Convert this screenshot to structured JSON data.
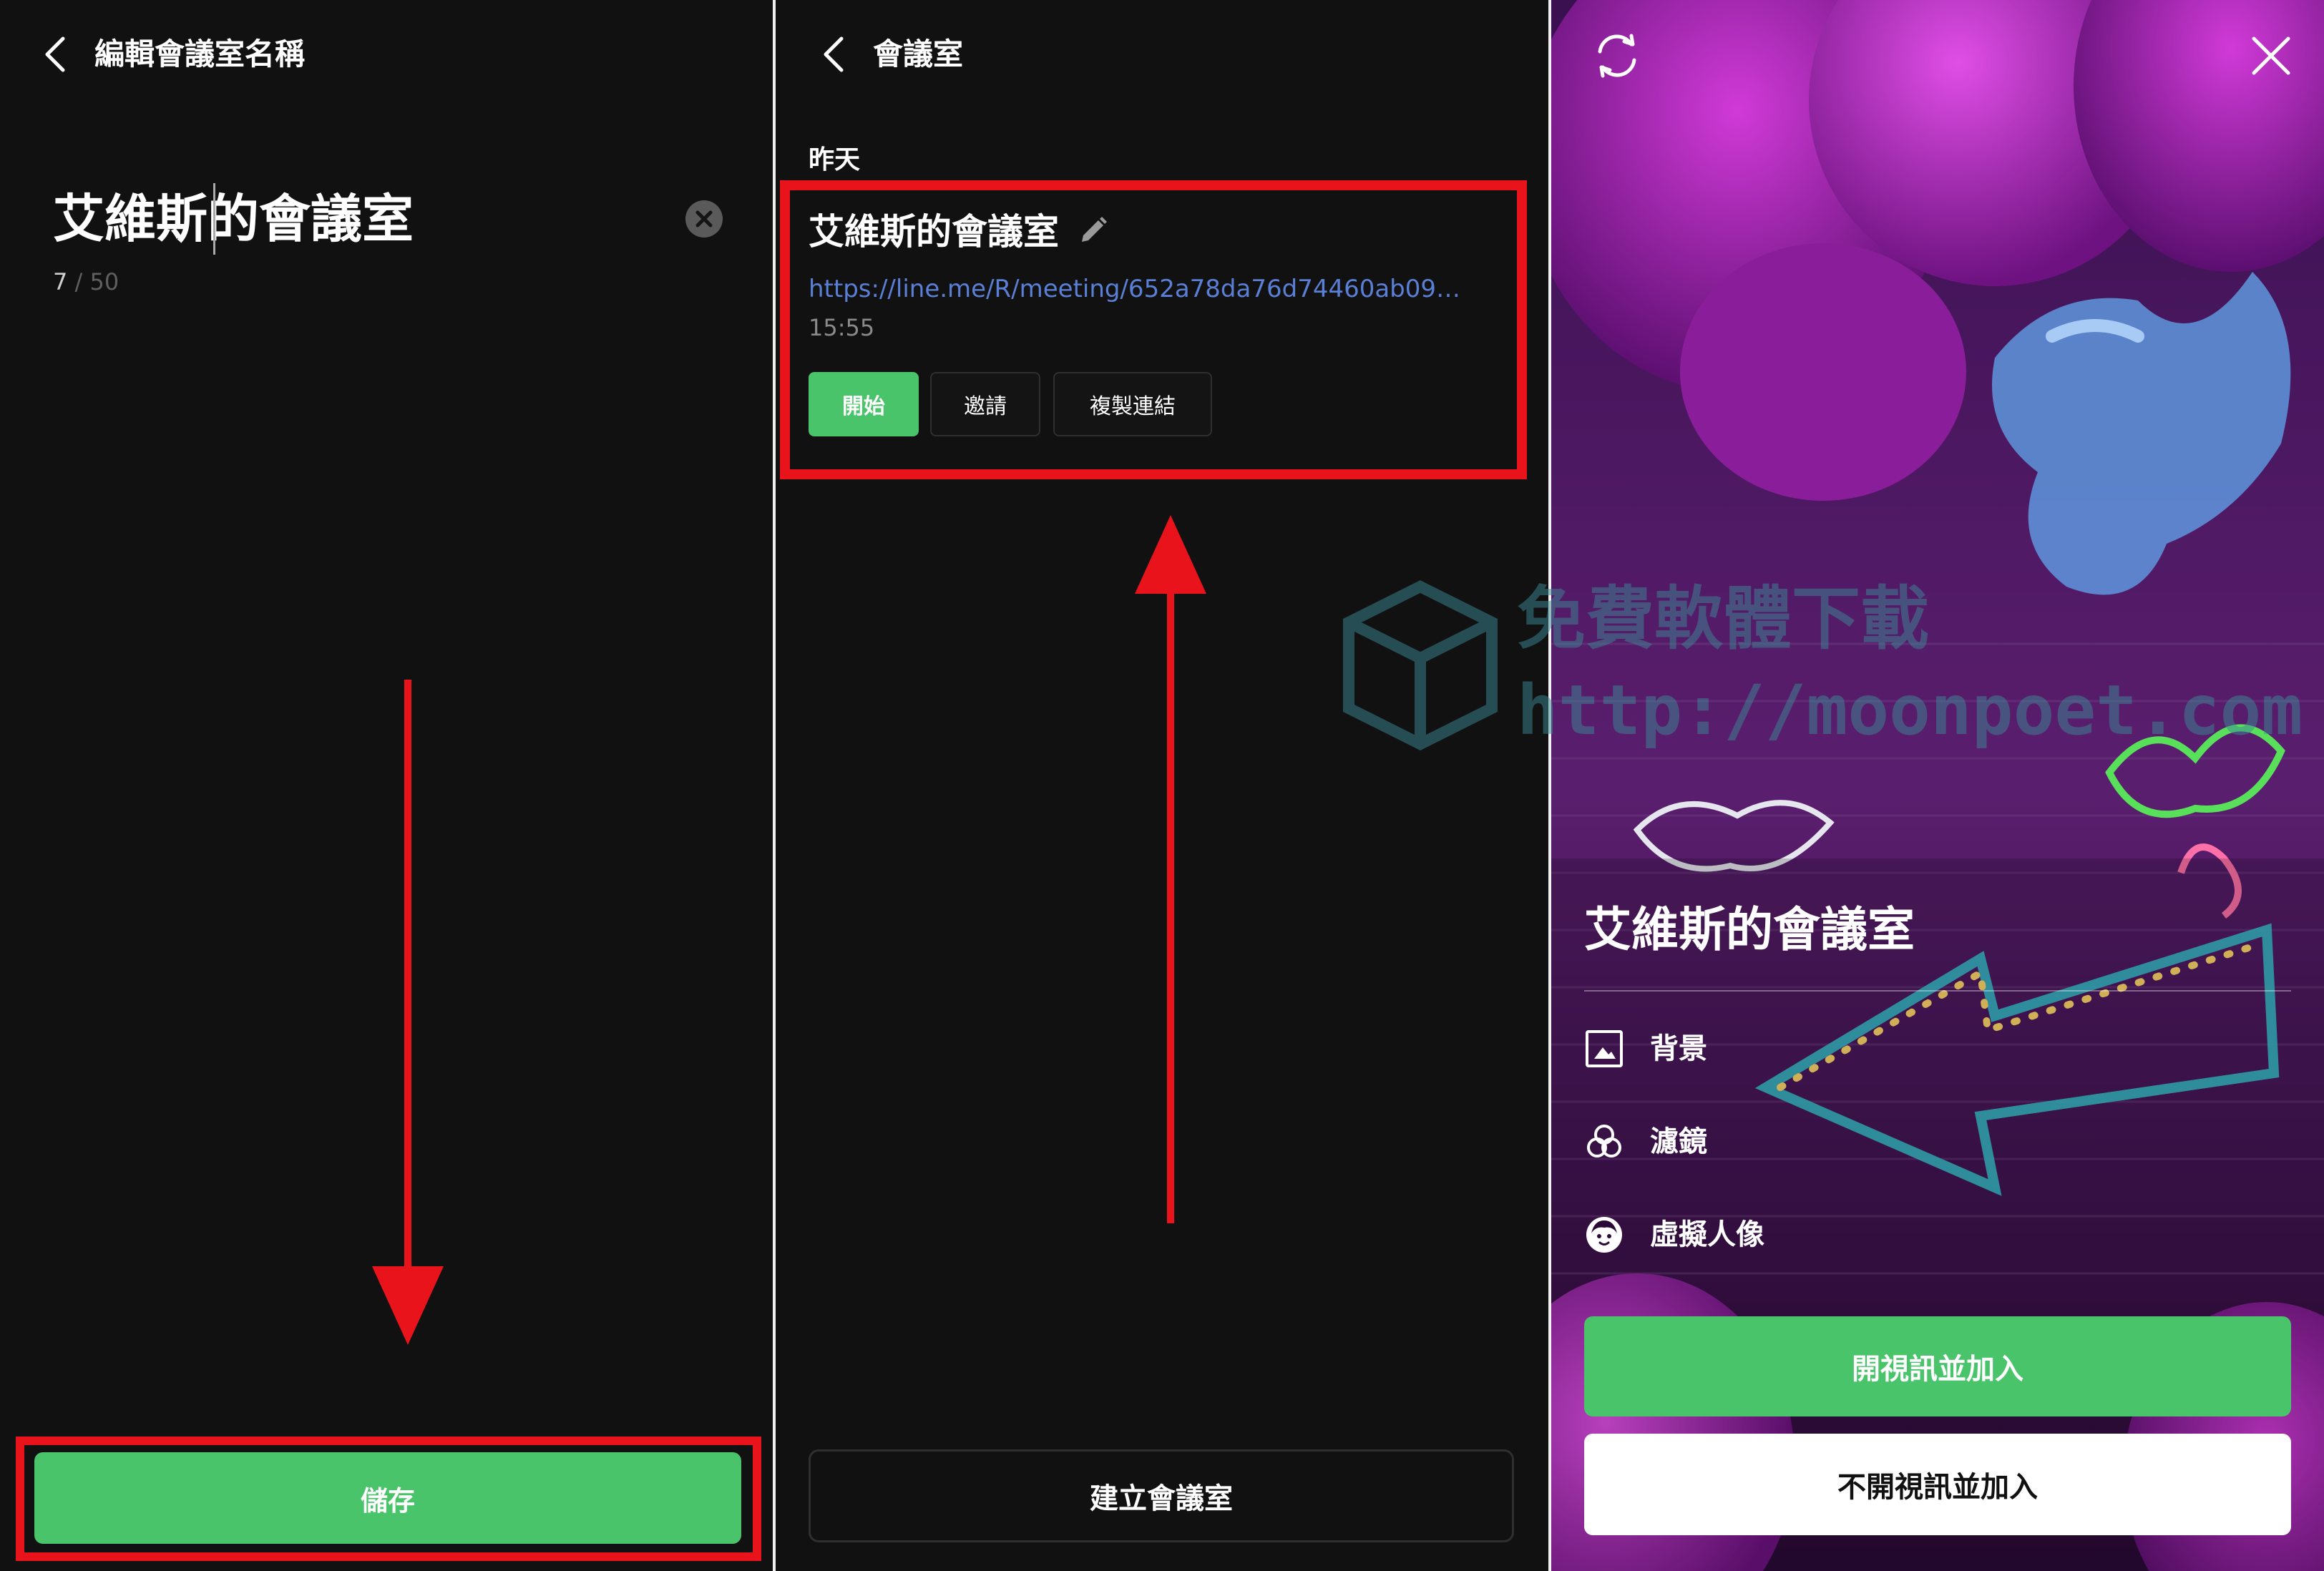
{
  "panel_edit": {
    "title": "編輯會議室名稱",
    "name_value": "艾維斯的會議室",
    "counter_current": "7",
    "counter_sep": " / ",
    "counter_max": "50",
    "save_label": "儲存"
  },
  "panel_rooms": {
    "title": "會議室",
    "section_label": "昨天",
    "room": {
      "name": "艾維斯的會議室",
      "link": "https://line.me/R/meeting/652a78da76d74460ab090…",
      "time": "15:55",
      "start_label": "開始",
      "invite_label": "邀請",
      "copy_label": "複製連結"
    },
    "create_label": "建立會議室"
  },
  "panel_join": {
    "room_name": "艾維斯的會議室",
    "options": [
      {
        "label": "背景",
        "icon": "image-icon"
      },
      {
        "label": "濾鏡",
        "icon": "filter-icon"
      },
      {
        "label": "虛擬人像",
        "icon": "avatar-icon"
      }
    ],
    "video_join_label": "開視訊並加入",
    "audio_join_label": "不開視訊並加入"
  },
  "watermark": {
    "line1": "免費軟體下載",
    "line2": "http://moonpoet.com"
  },
  "colors": {
    "accent_green": "#4ac46a",
    "annotation_red": "#e8131b",
    "link_blue": "#5a7fd6",
    "panel_bg": "#111111"
  }
}
